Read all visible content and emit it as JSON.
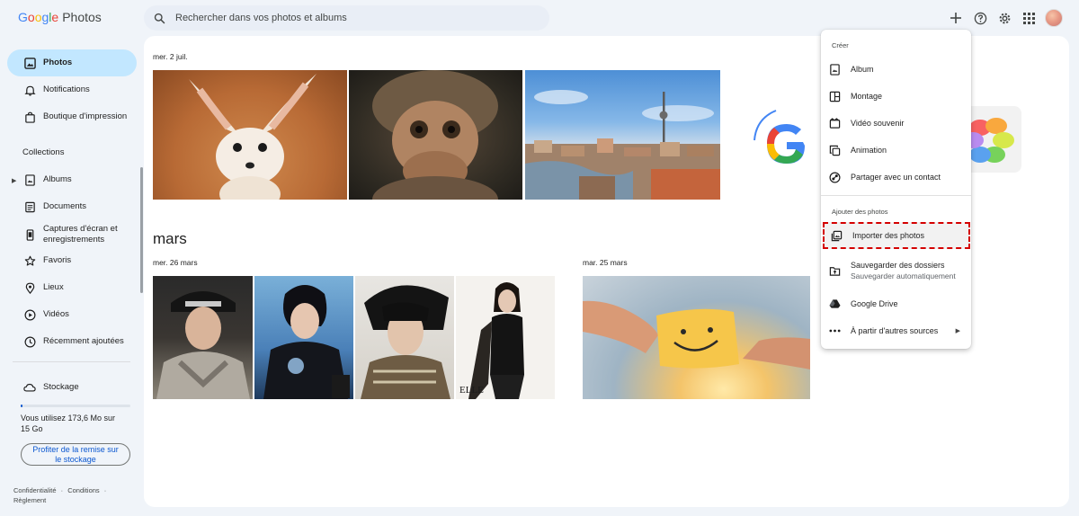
{
  "header": {
    "logo_google": "Google",
    "logo_product": "Photos",
    "search_placeholder": "Rechercher dans vos photos et albums"
  },
  "colors": {
    "accent": "#0b57d0",
    "active_nav": "#c2e7ff",
    "highlight_outline": "#d40000"
  },
  "sidebar": {
    "items": [
      {
        "label": "Photos",
        "icon": "photo-icon"
      },
      {
        "label": "Notifications",
        "icon": "bell-icon"
      },
      {
        "label": "Boutique d'impression",
        "icon": "shopping-bag-icon"
      }
    ],
    "collections_title": "Collections",
    "collections": [
      {
        "label": "Albums",
        "icon": "album-icon"
      },
      {
        "label": "Documents",
        "icon": "document-icon"
      },
      {
        "label": "Captures d'écran et enregistrements",
        "icon": "phone-screenshot-icon"
      },
      {
        "label": "Favoris",
        "icon": "star-icon"
      },
      {
        "label": "Lieux",
        "icon": "location-pin-icon"
      },
      {
        "label": "Vidéos",
        "icon": "play-circle-icon"
      },
      {
        "label": "Récemment ajoutées",
        "icon": "clock-icon"
      }
    ],
    "storage_label": "Stockage",
    "storage_text": "Vous utilisez 173,6 Mo sur 15 Go",
    "storage_fraction": 0.012,
    "storage_button": "Profiter de la remise sur le stockage",
    "footer": {
      "privacy": "Confidentialité",
      "sep1": "·",
      "terms": "Conditions",
      "sep2": "·",
      "rules": "Règlement"
    }
  },
  "main": {
    "groups": [
      {
        "date": "mer. 2 juil."
      },
      {
        "month": "mars"
      },
      {
        "date": "mer. 26 mars"
      },
      {
        "date": "mar. 25 mars"
      }
    ]
  },
  "menu": {
    "create_title": "Créer",
    "create_items": [
      {
        "label": "Album",
        "icon": "album-icon"
      },
      {
        "label": "Montage",
        "icon": "collage-icon"
      },
      {
        "label": "Vidéo souvenir",
        "icon": "movie-icon"
      },
      {
        "label": "Animation",
        "icon": "animation-icon"
      },
      {
        "label": "Partager avec un contact",
        "icon": "share-contact-icon"
      }
    ],
    "add_title": "Ajouter des photos",
    "add_items": [
      {
        "label": "Importer des photos",
        "icon": "import-photo-icon"
      },
      {
        "label": "Sauvegarder des dossiers",
        "sub": "Sauvegarder automatiquement",
        "icon": "folder-backup-icon"
      },
      {
        "label": "Google Drive",
        "icon": "google-drive-icon"
      },
      {
        "label": "À partir d'autres sources",
        "icon": "more-horiz-icon"
      }
    ]
  }
}
